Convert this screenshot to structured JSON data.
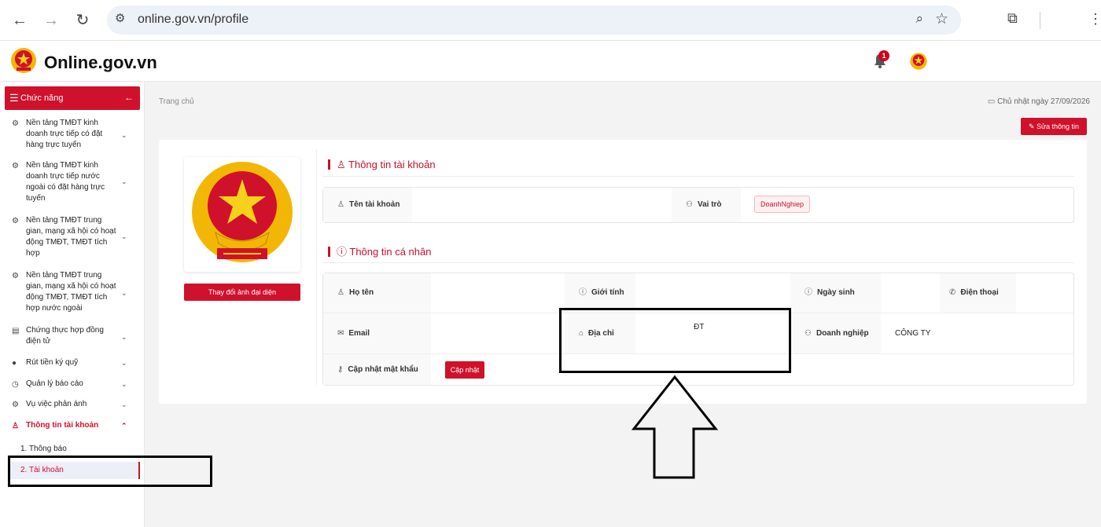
{
  "browser": {
    "url": "online.gov.vn/profile"
  },
  "header": {
    "brand": "Online.gov.vn",
    "notification_count": "1"
  },
  "sidebar": {
    "menu_label": "Chức năng",
    "items": [
      {
        "label": "Nền tảng TMĐT kinh doanh trực tiếp có đặt hàng trực tuyến"
      },
      {
        "label": "Nền tảng TMĐT kinh doanh trực tiếp nước ngoài có đặt hàng trực tuyến"
      },
      {
        "label": "Nền tảng TMĐT trung gian, mạng xã hội có hoạt động TMĐT, TMĐT tích hợp"
      },
      {
        "label": "Nền tảng TMĐT trung gian, mạng xã hội có hoạt động TMĐT, TMĐT tích hợp nước ngoài"
      },
      {
        "label": "Chứng thực hợp đồng điện tử"
      },
      {
        "label": "Rút tiền ký quỹ"
      },
      {
        "label": "Quản lý báo cáo"
      },
      {
        "label": "Vụ việc phản ánh"
      },
      {
        "label": "Thông tin tài khoản"
      }
    ],
    "subitems": [
      {
        "label": "1. Thông báo"
      },
      {
        "label": "2. Tài khoản"
      }
    ]
  },
  "main": {
    "breadcrumb": "Trang chủ",
    "date": "Chủ nhật ngày 27/09/2026",
    "edit_button": "Sửa thông tin",
    "change_avatar_button": "Thay đổi ảnh đại diện",
    "account_section": {
      "title": "Thông tin tài khoản",
      "username_label": "Tên tài khoản",
      "username_value": "",
      "role_label": "Vai trò",
      "role_value": "DoanhNghiep"
    },
    "personal_section": {
      "title": "Thông tin cá nhân",
      "fullname_label": "Họ tên",
      "fullname_value": "",
      "gender_label": "Giới tính",
      "gender_value": "",
      "birthday_label": "Ngày sinh",
      "birthday_value": "",
      "phone_label": "Điện thoại",
      "phone_value": "",
      "email_label": "Email",
      "email_value": "",
      "address_label": "Địa chỉ",
      "address_value": "ĐT",
      "company_label": "Doanh nghiệp",
      "company_value": "CÔNG TY",
      "password_label": "Cập nhật mật khẩu",
      "password_button": "Cập nhật"
    }
  },
  "colors": {
    "accent": "#d0112b",
    "annotation": "#000000"
  }
}
